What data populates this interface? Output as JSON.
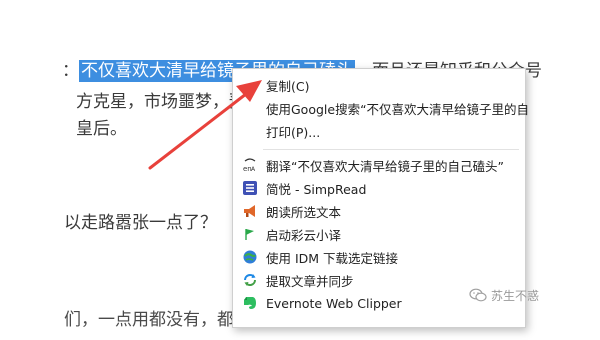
{
  "article": {
    "line1_prefix": "：",
    "line1_highlight": "不仅喜欢大清早给镜子里的自己磕头",
    "line1_suffix": "，而且还是知乎和公众号",
    "line2": "方克星，市场噩梦，预",
    "line3": "皇后。",
    "line4": "以走路嚣张一点了？",
    "line5": "们，一点用都没有，都"
  },
  "context_menu": {
    "items": [
      {
        "label": "复制(C)",
        "icon": "none"
      },
      {
        "label": "使用Google搜索“不仅喜欢大清早给镜子里的自",
        "icon": "none"
      },
      {
        "label": "打印(P)...",
        "icon": "none"
      },
      {
        "label": "翻译“不仅喜欢大清早给镜子里的自己磕头”",
        "icon": "translate-icon"
      },
      {
        "label": "简悦 - SimpRead",
        "icon": "simpread-icon"
      },
      {
        "label": "朗读所选文本",
        "icon": "megaphone-icon"
      },
      {
        "label": "启动彩云小译",
        "icon": "caiyun-flag-icon"
      },
      {
        "label": "使用 IDM 下载选定链接",
        "icon": "idm-globe-icon"
      },
      {
        "label": "提取文章并同步",
        "icon": "sync-icon"
      },
      {
        "label": "Evernote Web Clipper",
        "icon": "evernote-elephant-icon"
      }
    ]
  },
  "watermark": {
    "text": "苏生不惑",
    "icon": "wechat-icon"
  },
  "colors": {
    "selection": "#3d8ee0",
    "arrow": "#e8413b",
    "menu_border": "#cfcfcf"
  }
}
